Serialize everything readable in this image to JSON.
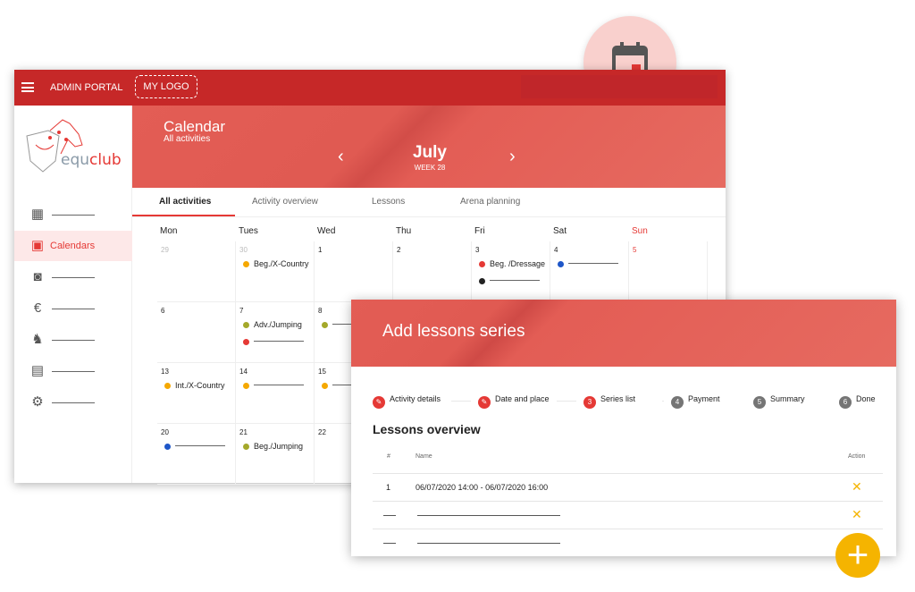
{
  "topbar": {
    "title": "ADMIN PORTAL",
    "logo": "MY LOGO"
  },
  "sidebar": {
    "brand": "equclub",
    "items": [
      {
        "icon": "dashboard-icon"
      },
      {
        "icon": "calendar-icon",
        "label": "Calendars",
        "active": true
      },
      {
        "icon": "contact-icon"
      },
      {
        "icon": "euro-icon"
      },
      {
        "icon": "horse-icon"
      },
      {
        "icon": "clipboard-icon"
      },
      {
        "icon": "gear-icon"
      }
    ]
  },
  "hero": {
    "title": "Calendar",
    "subtitle": "All activities",
    "month": "July",
    "week": "WEEK 28"
  },
  "tabs": [
    "All activities",
    "Activity overview",
    "Lessons",
    "Arena planning"
  ],
  "calendar": {
    "days": [
      "Mon",
      "Tues",
      "Wed",
      "Thu",
      "Fri",
      "Sat",
      "Sun"
    ],
    "weeks": [
      [
        "29",
        "30",
        "1",
        "2",
        "3",
        "4",
        "5"
      ],
      [
        "6",
        "7",
        "8",
        "",
        "",
        "",
        ""
      ],
      [
        "13",
        "14",
        "15",
        "",
        "",
        "",
        ""
      ],
      [
        "20",
        "21",
        "22",
        "",
        "",
        "",
        ""
      ]
    ],
    "events": {
      "30": [
        {
          "label": "Beg./X-Country",
          "color": "#f5a800"
        }
      ],
      "3": [
        {
          "label": "Beg. /Dressage",
          "color": "#e53935"
        },
        {
          "label": "",
          "color": "#222222"
        }
      ],
      "4": [
        {
          "label": "",
          "color": "#1e56c8"
        }
      ],
      "7": [
        {
          "label": "Adv./Jumping",
          "color": "#a4a82a"
        },
        {
          "label": "",
          "color": "#e53935"
        }
      ],
      "8": [
        {
          "label": "",
          "color": "#a4a82a"
        }
      ],
      "13": [
        {
          "label": "Int./X-Country",
          "color": "#f5a800"
        }
      ],
      "14": [
        {
          "label": "",
          "color": "#f5a800"
        }
      ],
      "15": [
        {
          "label": "",
          "color": "#f5a800"
        }
      ],
      "20": [
        {
          "label": "",
          "color": "#1e56c8"
        }
      ],
      "21": [
        {
          "label": "Beg./Jumping",
          "color": "#a4a82a"
        }
      ]
    }
  },
  "dialog": {
    "title": "Add lessons series",
    "steps": [
      {
        "num": "✎",
        "label": "Activity details",
        "state": "done"
      },
      {
        "num": "✎",
        "label": "Date and place",
        "state": "done"
      },
      {
        "num": "3",
        "label": "Series list",
        "state": "active"
      },
      {
        "num": "4",
        "label": "Payment",
        "state": "todo"
      },
      {
        "num": "5",
        "label": "Summary",
        "state": "todo"
      },
      {
        "num": "6",
        "label": "Done",
        "state": "todo"
      }
    ],
    "section": "Lessons overview",
    "columns": {
      "num": "#",
      "name": "Name",
      "action": "Action"
    },
    "rows": [
      {
        "num": "1",
        "name": "06/07/2020 14:00 - 06/07/2020 16:00"
      }
    ]
  },
  "colors": {
    "primary": "#c62828",
    "accent": "#e53935",
    "fab": "#f5b400"
  }
}
